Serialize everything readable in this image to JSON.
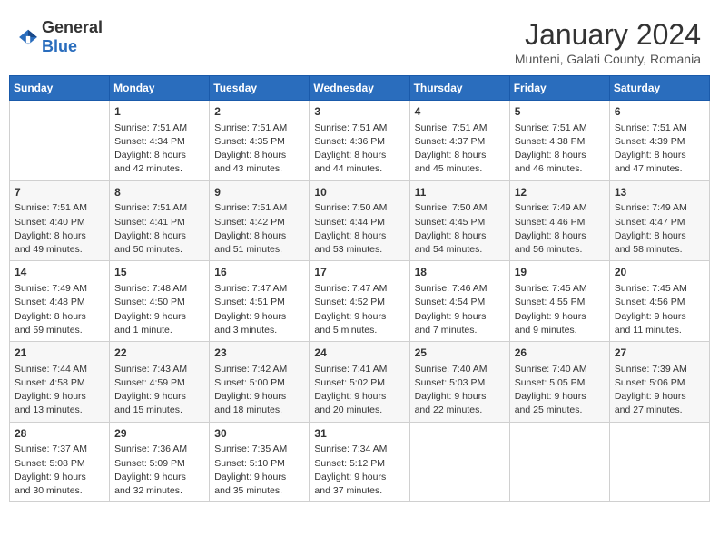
{
  "logo": {
    "text_general": "General",
    "text_blue": "Blue"
  },
  "header": {
    "month": "January 2024",
    "location": "Munteni, Galati County, Romania"
  },
  "weekdays": [
    "Sunday",
    "Monday",
    "Tuesday",
    "Wednesday",
    "Thursday",
    "Friday",
    "Saturday"
  ],
  "weeks": [
    [
      {
        "day": "",
        "info": ""
      },
      {
        "day": "1",
        "info": "Sunrise: 7:51 AM\nSunset: 4:34 PM\nDaylight: 8 hours\nand 42 minutes."
      },
      {
        "day": "2",
        "info": "Sunrise: 7:51 AM\nSunset: 4:35 PM\nDaylight: 8 hours\nand 43 minutes."
      },
      {
        "day": "3",
        "info": "Sunrise: 7:51 AM\nSunset: 4:36 PM\nDaylight: 8 hours\nand 44 minutes."
      },
      {
        "day": "4",
        "info": "Sunrise: 7:51 AM\nSunset: 4:37 PM\nDaylight: 8 hours\nand 45 minutes."
      },
      {
        "day": "5",
        "info": "Sunrise: 7:51 AM\nSunset: 4:38 PM\nDaylight: 8 hours\nand 46 minutes."
      },
      {
        "day": "6",
        "info": "Sunrise: 7:51 AM\nSunset: 4:39 PM\nDaylight: 8 hours\nand 47 minutes."
      }
    ],
    [
      {
        "day": "7",
        "info": "Sunrise: 7:51 AM\nSunset: 4:40 PM\nDaylight: 8 hours\nand 49 minutes."
      },
      {
        "day": "8",
        "info": "Sunrise: 7:51 AM\nSunset: 4:41 PM\nDaylight: 8 hours\nand 50 minutes."
      },
      {
        "day": "9",
        "info": "Sunrise: 7:51 AM\nSunset: 4:42 PM\nDaylight: 8 hours\nand 51 minutes."
      },
      {
        "day": "10",
        "info": "Sunrise: 7:50 AM\nSunset: 4:44 PM\nDaylight: 8 hours\nand 53 minutes."
      },
      {
        "day": "11",
        "info": "Sunrise: 7:50 AM\nSunset: 4:45 PM\nDaylight: 8 hours\nand 54 minutes."
      },
      {
        "day": "12",
        "info": "Sunrise: 7:49 AM\nSunset: 4:46 PM\nDaylight: 8 hours\nand 56 minutes."
      },
      {
        "day": "13",
        "info": "Sunrise: 7:49 AM\nSunset: 4:47 PM\nDaylight: 8 hours\nand 58 minutes."
      }
    ],
    [
      {
        "day": "14",
        "info": "Sunrise: 7:49 AM\nSunset: 4:48 PM\nDaylight: 8 hours\nand 59 minutes."
      },
      {
        "day": "15",
        "info": "Sunrise: 7:48 AM\nSunset: 4:50 PM\nDaylight: 9 hours\nand 1 minute."
      },
      {
        "day": "16",
        "info": "Sunrise: 7:47 AM\nSunset: 4:51 PM\nDaylight: 9 hours\nand 3 minutes."
      },
      {
        "day": "17",
        "info": "Sunrise: 7:47 AM\nSunset: 4:52 PM\nDaylight: 9 hours\nand 5 minutes."
      },
      {
        "day": "18",
        "info": "Sunrise: 7:46 AM\nSunset: 4:54 PM\nDaylight: 9 hours\nand 7 minutes."
      },
      {
        "day": "19",
        "info": "Sunrise: 7:45 AM\nSunset: 4:55 PM\nDaylight: 9 hours\nand 9 minutes."
      },
      {
        "day": "20",
        "info": "Sunrise: 7:45 AM\nSunset: 4:56 PM\nDaylight: 9 hours\nand 11 minutes."
      }
    ],
    [
      {
        "day": "21",
        "info": "Sunrise: 7:44 AM\nSunset: 4:58 PM\nDaylight: 9 hours\nand 13 minutes."
      },
      {
        "day": "22",
        "info": "Sunrise: 7:43 AM\nSunset: 4:59 PM\nDaylight: 9 hours\nand 15 minutes."
      },
      {
        "day": "23",
        "info": "Sunrise: 7:42 AM\nSunset: 5:00 PM\nDaylight: 9 hours\nand 18 minutes."
      },
      {
        "day": "24",
        "info": "Sunrise: 7:41 AM\nSunset: 5:02 PM\nDaylight: 9 hours\nand 20 minutes."
      },
      {
        "day": "25",
        "info": "Sunrise: 7:40 AM\nSunset: 5:03 PM\nDaylight: 9 hours\nand 22 minutes."
      },
      {
        "day": "26",
        "info": "Sunrise: 7:40 AM\nSunset: 5:05 PM\nDaylight: 9 hours\nand 25 minutes."
      },
      {
        "day": "27",
        "info": "Sunrise: 7:39 AM\nSunset: 5:06 PM\nDaylight: 9 hours\nand 27 minutes."
      }
    ],
    [
      {
        "day": "28",
        "info": "Sunrise: 7:37 AM\nSunset: 5:08 PM\nDaylight: 9 hours\nand 30 minutes."
      },
      {
        "day": "29",
        "info": "Sunrise: 7:36 AM\nSunset: 5:09 PM\nDaylight: 9 hours\nand 32 minutes."
      },
      {
        "day": "30",
        "info": "Sunrise: 7:35 AM\nSunset: 5:10 PM\nDaylight: 9 hours\nand 35 minutes."
      },
      {
        "day": "31",
        "info": "Sunrise: 7:34 AM\nSunset: 5:12 PM\nDaylight: 9 hours\nand 37 minutes."
      },
      {
        "day": "",
        "info": ""
      },
      {
        "day": "",
        "info": ""
      },
      {
        "day": "",
        "info": ""
      }
    ]
  ]
}
